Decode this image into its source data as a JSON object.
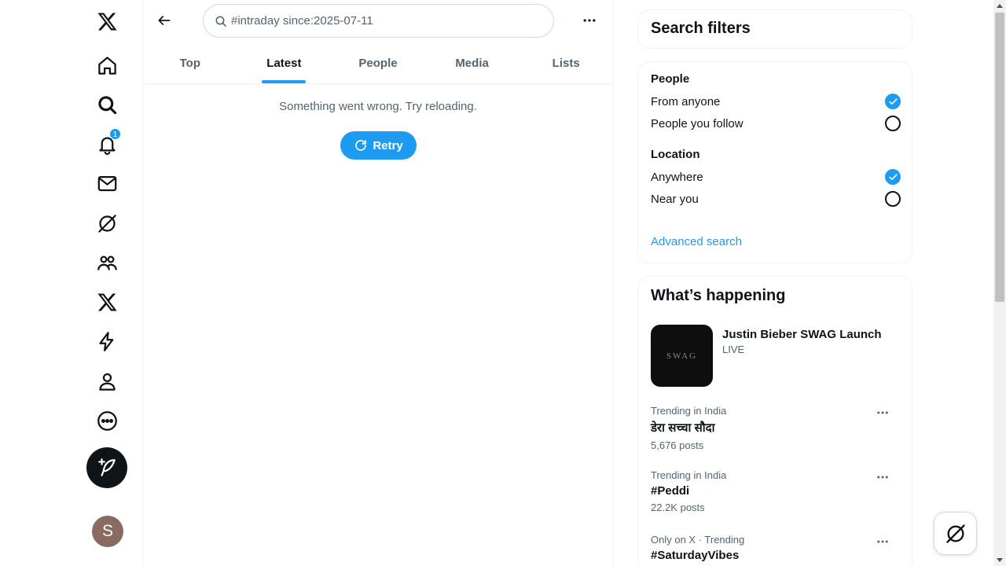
{
  "nav": {
    "items": [
      {
        "name": "x-logo-icon"
      },
      {
        "name": "home-icon"
      },
      {
        "name": "explore-icon"
      },
      {
        "name": "notifications-icon",
        "badge": "1"
      },
      {
        "name": "messages-icon"
      },
      {
        "name": "grok-icon"
      },
      {
        "name": "communities-icon"
      },
      {
        "name": "premium-icon"
      },
      {
        "name": "verified-orgs-icon"
      },
      {
        "name": "profile-icon"
      },
      {
        "name": "more-icon"
      }
    ],
    "compose_icon": "compose-post-icon",
    "avatar_initial": "S"
  },
  "search": {
    "value": "#intraday since:2025-07-11"
  },
  "tabs": [
    {
      "label": "Top",
      "active": false
    },
    {
      "label": "Latest",
      "active": true
    },
    {
      "label": "People",
      "active": false
    },
    {
      "label": "Media",
      "active": false
    },
    {
      "label": "Lists",
      "active": false
    }
  ],
  "feed": {
    "error_message": "Something went wrong. Try reloading.",
    "retry_label": "Retry"
  },
  "filters": {
    "title": "Search filters",
    "people_label": "People",
    "people_options": [
      {
        "label": "From anyone",
        "checked": true
      },
      {
        "label": "People you follow",
        "checked": false
      }
    ],
    "location_label": "Location",
    "location_options": [
      {
        "label": "Anywhere",
        "checked": true
      },
      {
        "label": "Near you",
        "checked": false
      }
    ],
    "advanced_link": "Advanced search"
  },
  "happening": {
    "title": "What’s happening",
    "live": {
      "thumb_text": "SWAG",
      "title": "Justin Bieber SWAG Launch",
      "status": "LIVE"
    },
    "trends": [
      {
        "context": "Trending in India",
        "name": "डेरा सच्चा सौदा",
        "count": "5,676 posts"
      },
      {
        "context": "Trending in India",
        "name": "#Peddi",
        "count": "22.2K posts"
      },
      {
        "context": "Only on X · Trending",
        "name": "#SaturdayVibes",
        "count": ""
      }
    ]
  },
  "colors": {
    "accent": "#1d9bf0",
    "text_primary": "#0f1419",
    "text_secondary": "#536471"
  }
}
